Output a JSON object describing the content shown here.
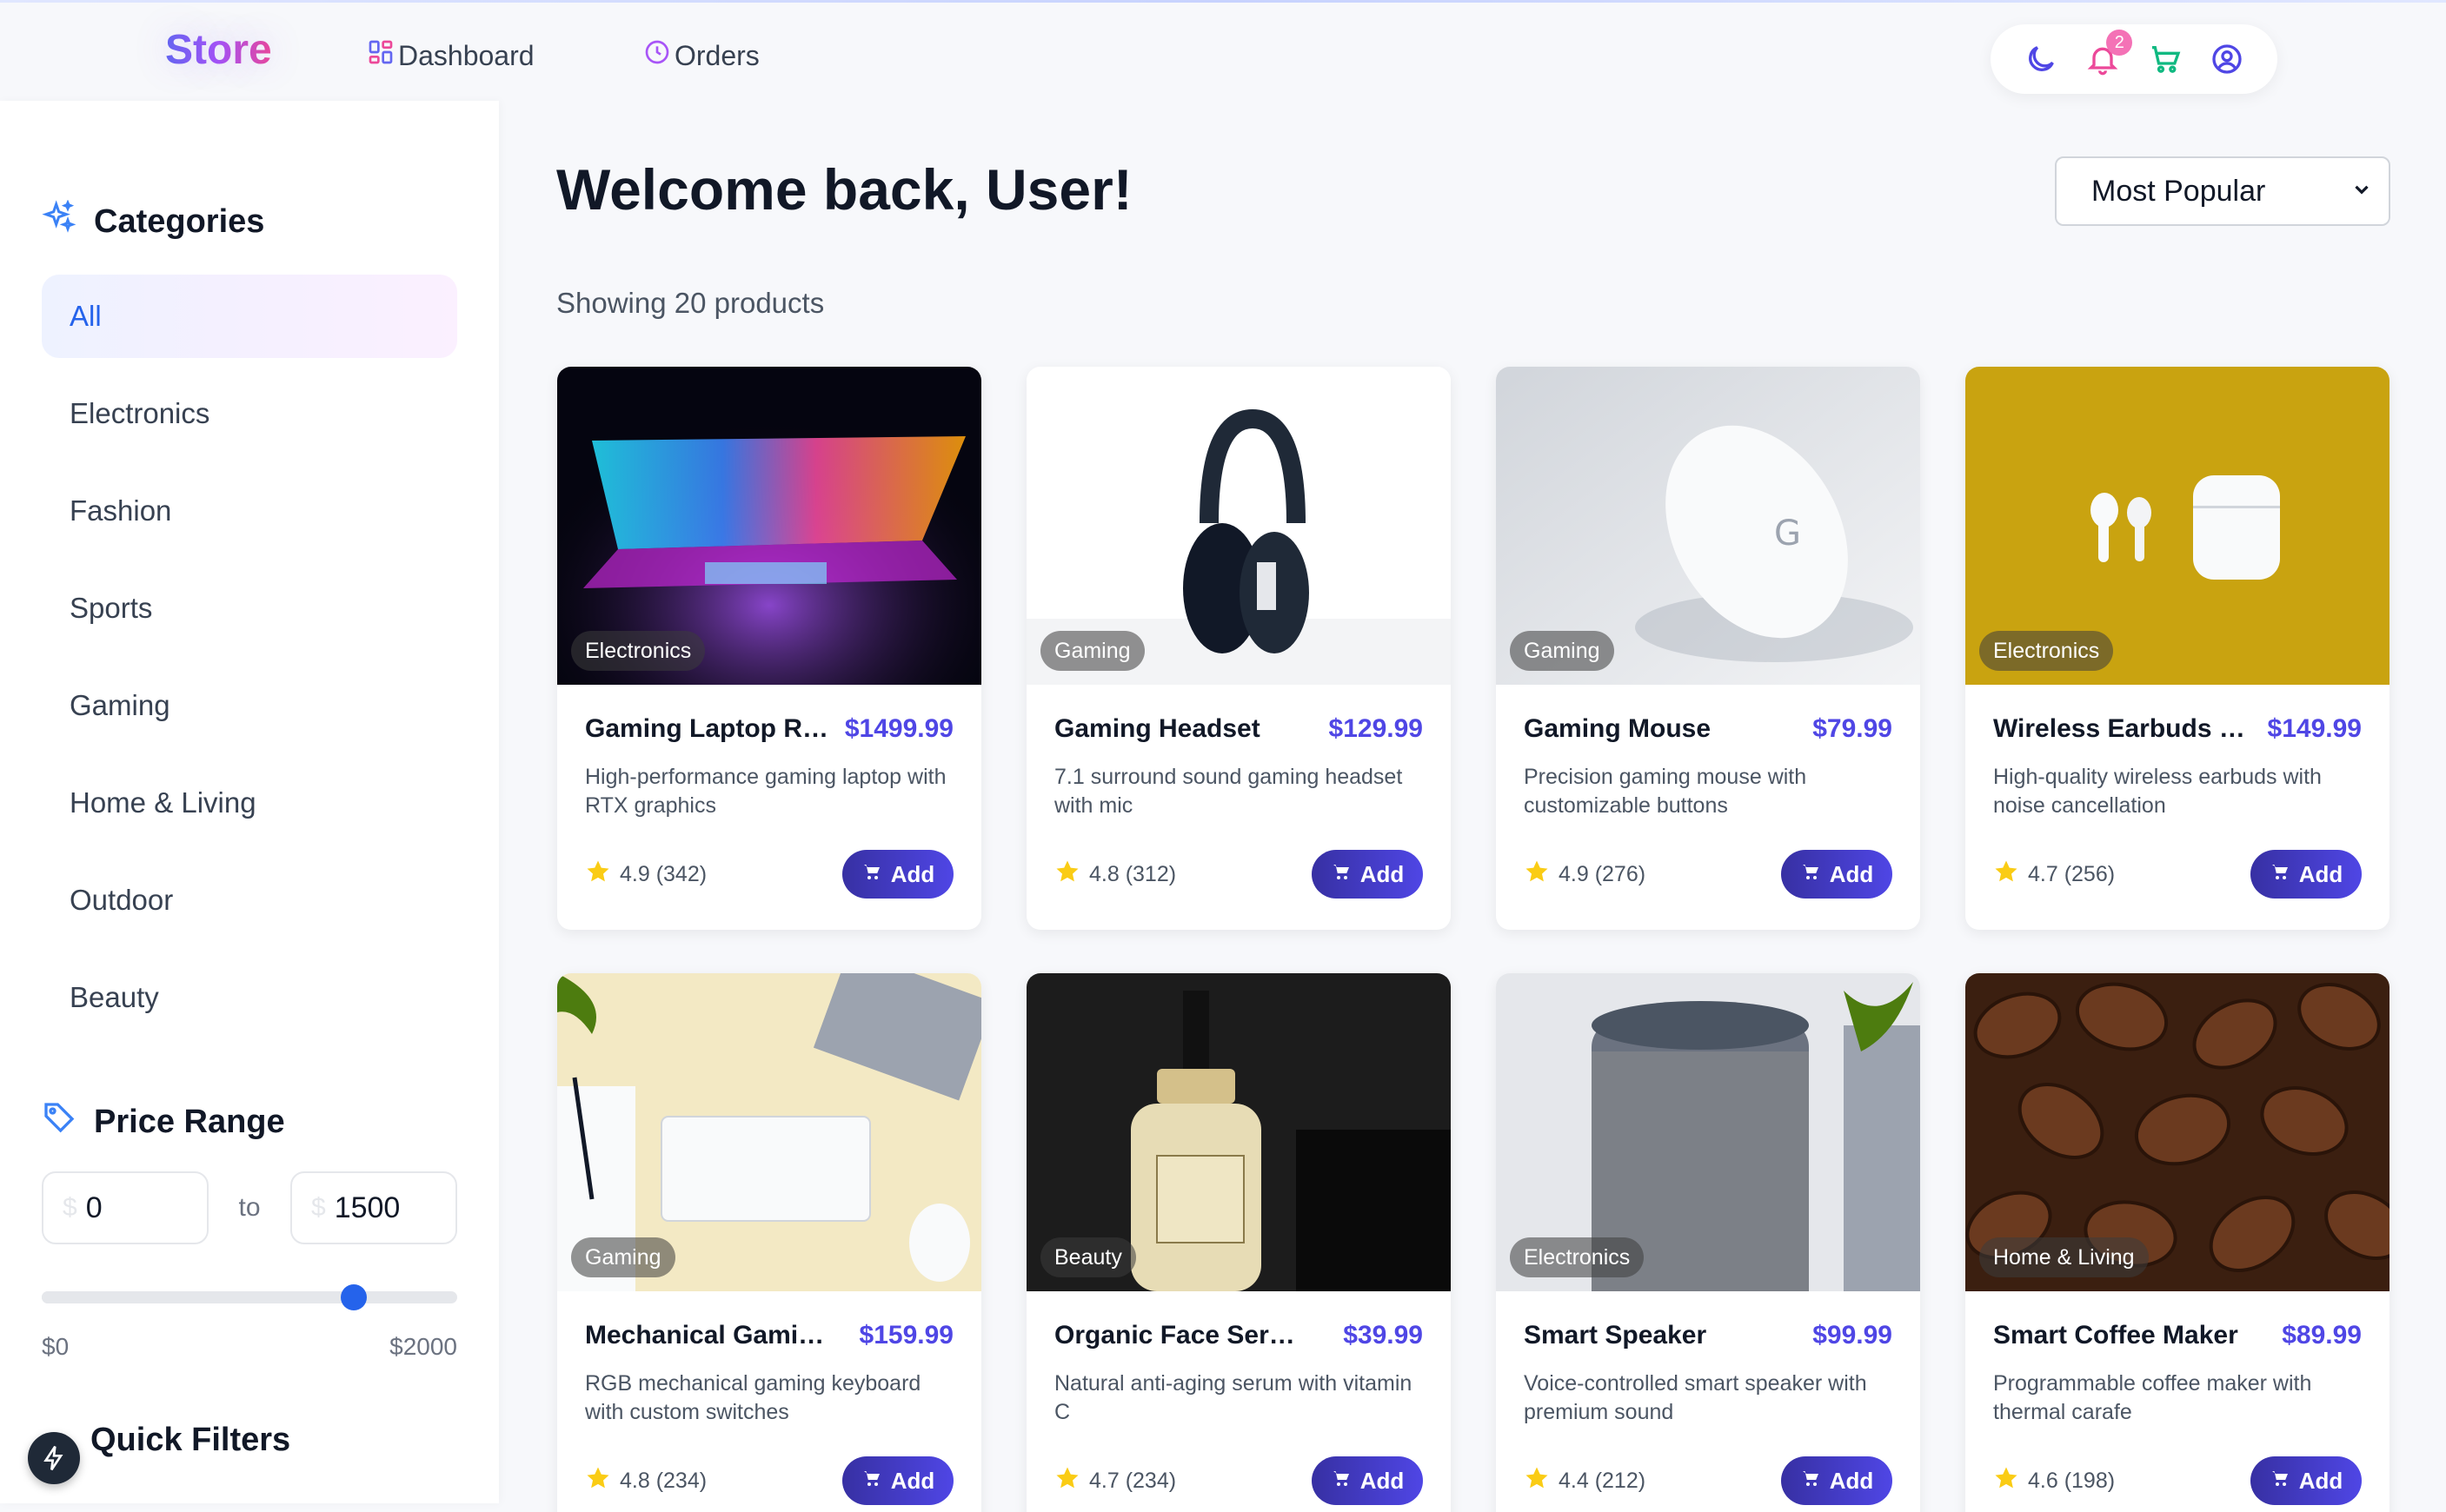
{
  "header": {
    "logo": "Store",
    "nav": [
      {
        "label": "Dashboard",
        "icon": "grid-icon"
      },
      {
        "label": "Orders",
        "icon": "clock-icon"
      }
    ],
    "notification_count": "2",
    "actions": [
      "moon-icon",
      "bell-icon",
      "cart-icon",
      "user-icon"
    ]
  },
  "sidebar": {
    "categories_title": "Categories",
    "categories": [
      "All",
      "Electronics",
      "Fashion",
      "Sports",
      "Gaming",
      "Home & Living",
      "Outdoor",
      "Beauty"
    ],
    "active_category": "All",
    "price_title": "Price Range",
    "price_currency": "$",
    "price_min": "0",
    "price_to": "to",
    "price_max": "1500",
    "slider_value_fraction": 0.75,
    "range_min_label": "$0",
    "range_max_label": "$2000",
    "quick_filters_title": "Quick Filters"
  },
  "main": {
    "welcome": "Welcome back, User!",
    "sort_selected": "Most Popular",
    "showing": "Showing 20 products",
    "add_label": "Add"
  },
  "products": [
    {
      "name": "Gaming Laptop RT...",
      "price": "$1499.99",
      "category": "Electronics",
      "desc": "High-performance gaming laptop with RTX graphics",
      "rating": "4.9 (342)"
    },
    {
      "name": "Gaming Headset",
      "price": "$129.99",
      "category": "Gaming",
      "desc": "7.1 surround sound gaming headset with mic",
      "rating": "4.8 (312)"
    },
    {
      "name": "Gaming Mouse",
      "price": "$79.99",
      "category": "Gaming",
      "desc": "Precision gaming mouse with customizable buttons",
      "rating": "4.9 (276)"
    },
    {
      "name": "Wireless Earbuds Pro",
      "price": "$149.99",
      "category": "Electronics",
      "desc": "High-quality wireless earbuds with noise cancellation",
      "rating": "4.7 (256)"
    },
    {
      "name": "Mechanical Gaming...",
      "price": "$159.99",
      "category": "Gaming",
      "desc": "RGB mechanical gaming keyboard with custom switches",
      "rating": "4.8 (234)"
    },
    {
      "name": "Organic Face Serum",
      "price": "$39.99",
      "category": "Beauty",
      "desc": "Natural anti-aging serum with vitamin C",
      "rating": "4.7 (234)"
    },
    {
      "name": "Smart Speaker",
      "price": "$99.99",
      "category": "Electronics",
      "desc": "Voice-controlled smart speaker with premium sound",
      "rating": "4.4 (212)"
    },
    {
      "name": "Smart Coffee Maker",
      "price": "$89.99",
      "category": "Home & Living",
      "desc": "Programmable coffee maker with thermal carafe",
      "rating": "4.6 (198)"
    }
  ],
  "colors": {
    "accent": "#4f46e5",
    "active_category_text": "#2563eb",
    "star": "#facc15"
  }
}
